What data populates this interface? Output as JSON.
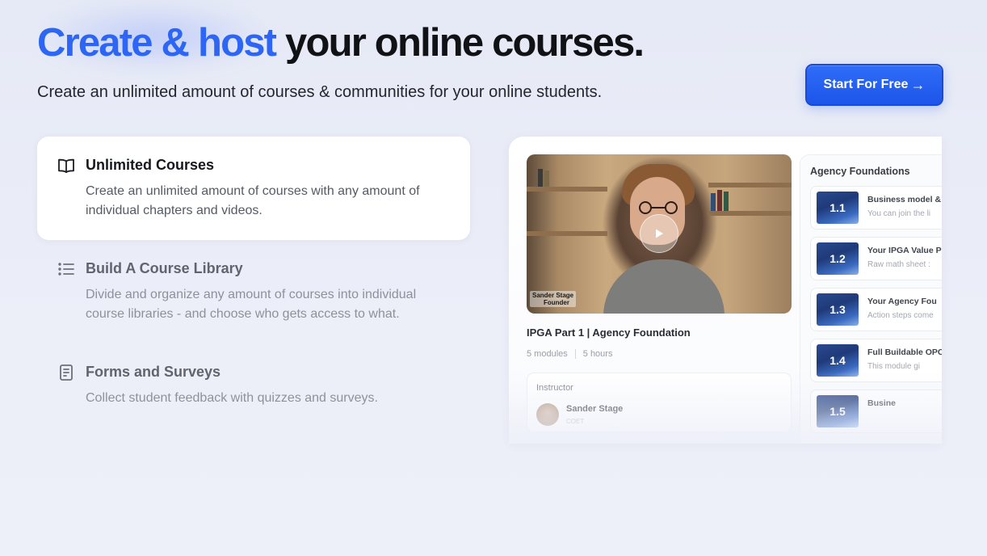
{
  "hero": {
    "title_accent": "Create & host",
    "title_rest": "your online courses.",
    "subtitle": "Create an unlimited amount of courses & communities for your online students.",
    "cta_label": "Start For Free",
    "cta_arrow": "→"
  },
  "features": [
    {
      "title": "Unlimited Courses",
      "description": "Create an unlimited amount of courses with any amount of individual chapters and videos.",
      "icon": "book-open-icon",
      "active": true
    },
    {
      "title": "Build A Course Library",
      "description": "Divide and organize any amount of courses into individual course libraries - and choose who gets access to what.",
      "icon": "list-icon",
      "active": false
    },
    {
      "title": "Forms and Surveys",
      "description": "Collect student feedback with quizzes and surveys.",
      "icon": "document-icon",
      "active": false
    }
  ],
  "preview": {
    "video_caption_name": "Sander Stage",
    "video_caption_role": "Founder",
    "course_title": "IPGA Part 1 | Agency Foundation",
    "modules_count": "5 modules",
    "duration": "5 hours",
    "instructor_label": "Instructor",
    "instructor_name": "Sander Stage",
    "instructor_role": "COET",
    "modules_title": "Agency Foundations",
    "modules": [
      {
        "number": "1.1",
        "name": "Business model &",
        "subtitle": "You can join the li"
      },
      {
        "number": "1.2",
        "name": "Your IPGA Value P",
        "subtitle": "Raw math sheet :"
      },
      {
        "number": "1.3",
        "name": "Your Agency Fou",
        "subtitle": "Action steps come"
      },
      {
        "number": "1.4",
        "name": "Full Buildable OPC",
        "subtitle": "This module gi"
      },
      {
        "number": "1.5",
        "name": "Busine",
        "subtitle": ""
      }
    ]
  },
  "colors": {
    "accent": "#2d66f5",
    "cta_background": "#1d55ea",
    "page_background": "#e8ebf7"
  }
}
